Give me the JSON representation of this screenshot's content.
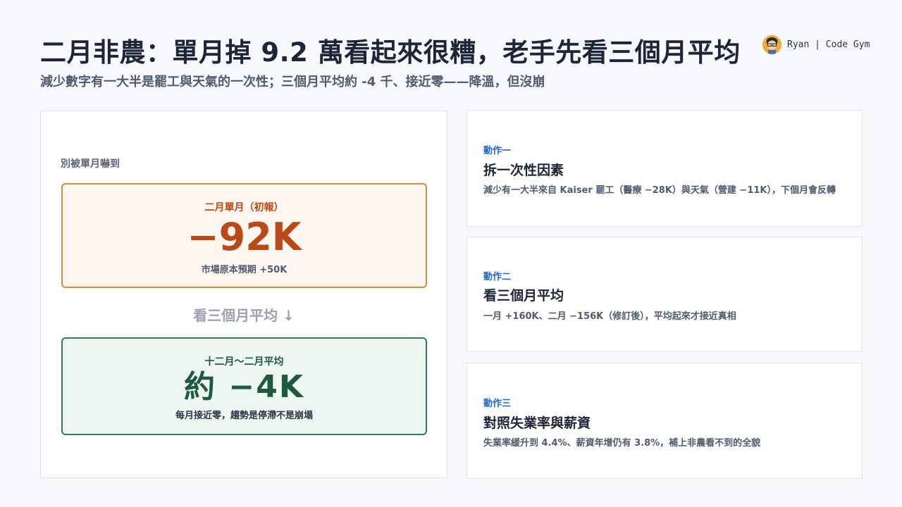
{
  "header": {
    "title": "二月非農：單月掉 9.2 萬看起來很糟，老手先看三個月平均",
    "subtitle": "減少數字有一大半是罷工與天氣的一次性；三個月平均約 -4 千、接近零——降溫，但沒崩"
  },
  "brand": {
    "name": "Ryan | Code Gym",
    "icon": "avatar-icon"
  },
  "left": {
    "label": "別被單月嚇到",
    "first_box": {
      "caption": "二月單月（初報）",
      "value": "−92K",
      "note": "市場原本預期 +50K"
    },
    "middle_label": "看三個月平均 ↓",
    "second_box": {
      "caption": "十二月～二月平均",
      "value": "約 −4K",
      "note": "每月接近零，趨勢是停滯不是崩塌"
    }
  },
  "actions": [
    {
      "kicker": "動作一",
      "title": "拆一次性因素",
      "desc": "減少有一大半來自 Kaiser 罷工（醫療 −28K）與天氣（營建 −11K），下個月會反轉"
    },
    {
      "kicker": "動作二",
      "title": "看三個月平均",
      "desc": "一月 +160K、二月 −156K（修訂後），平均起來才接近真相"
    },
    {
      "kicker": "動作三",
      "title": "對照失業率與薪資",
      "desc": "失業率緩升到 4.4%、薪資年增仍有 3.8%，補上非農看不到的全貌"
    }
  ],
  "colors": {
    "accent_blue": "#2366c9",
    "warning_orange": "#b94a17",
    "calm_green": "#1e5a3d"
  }
}
